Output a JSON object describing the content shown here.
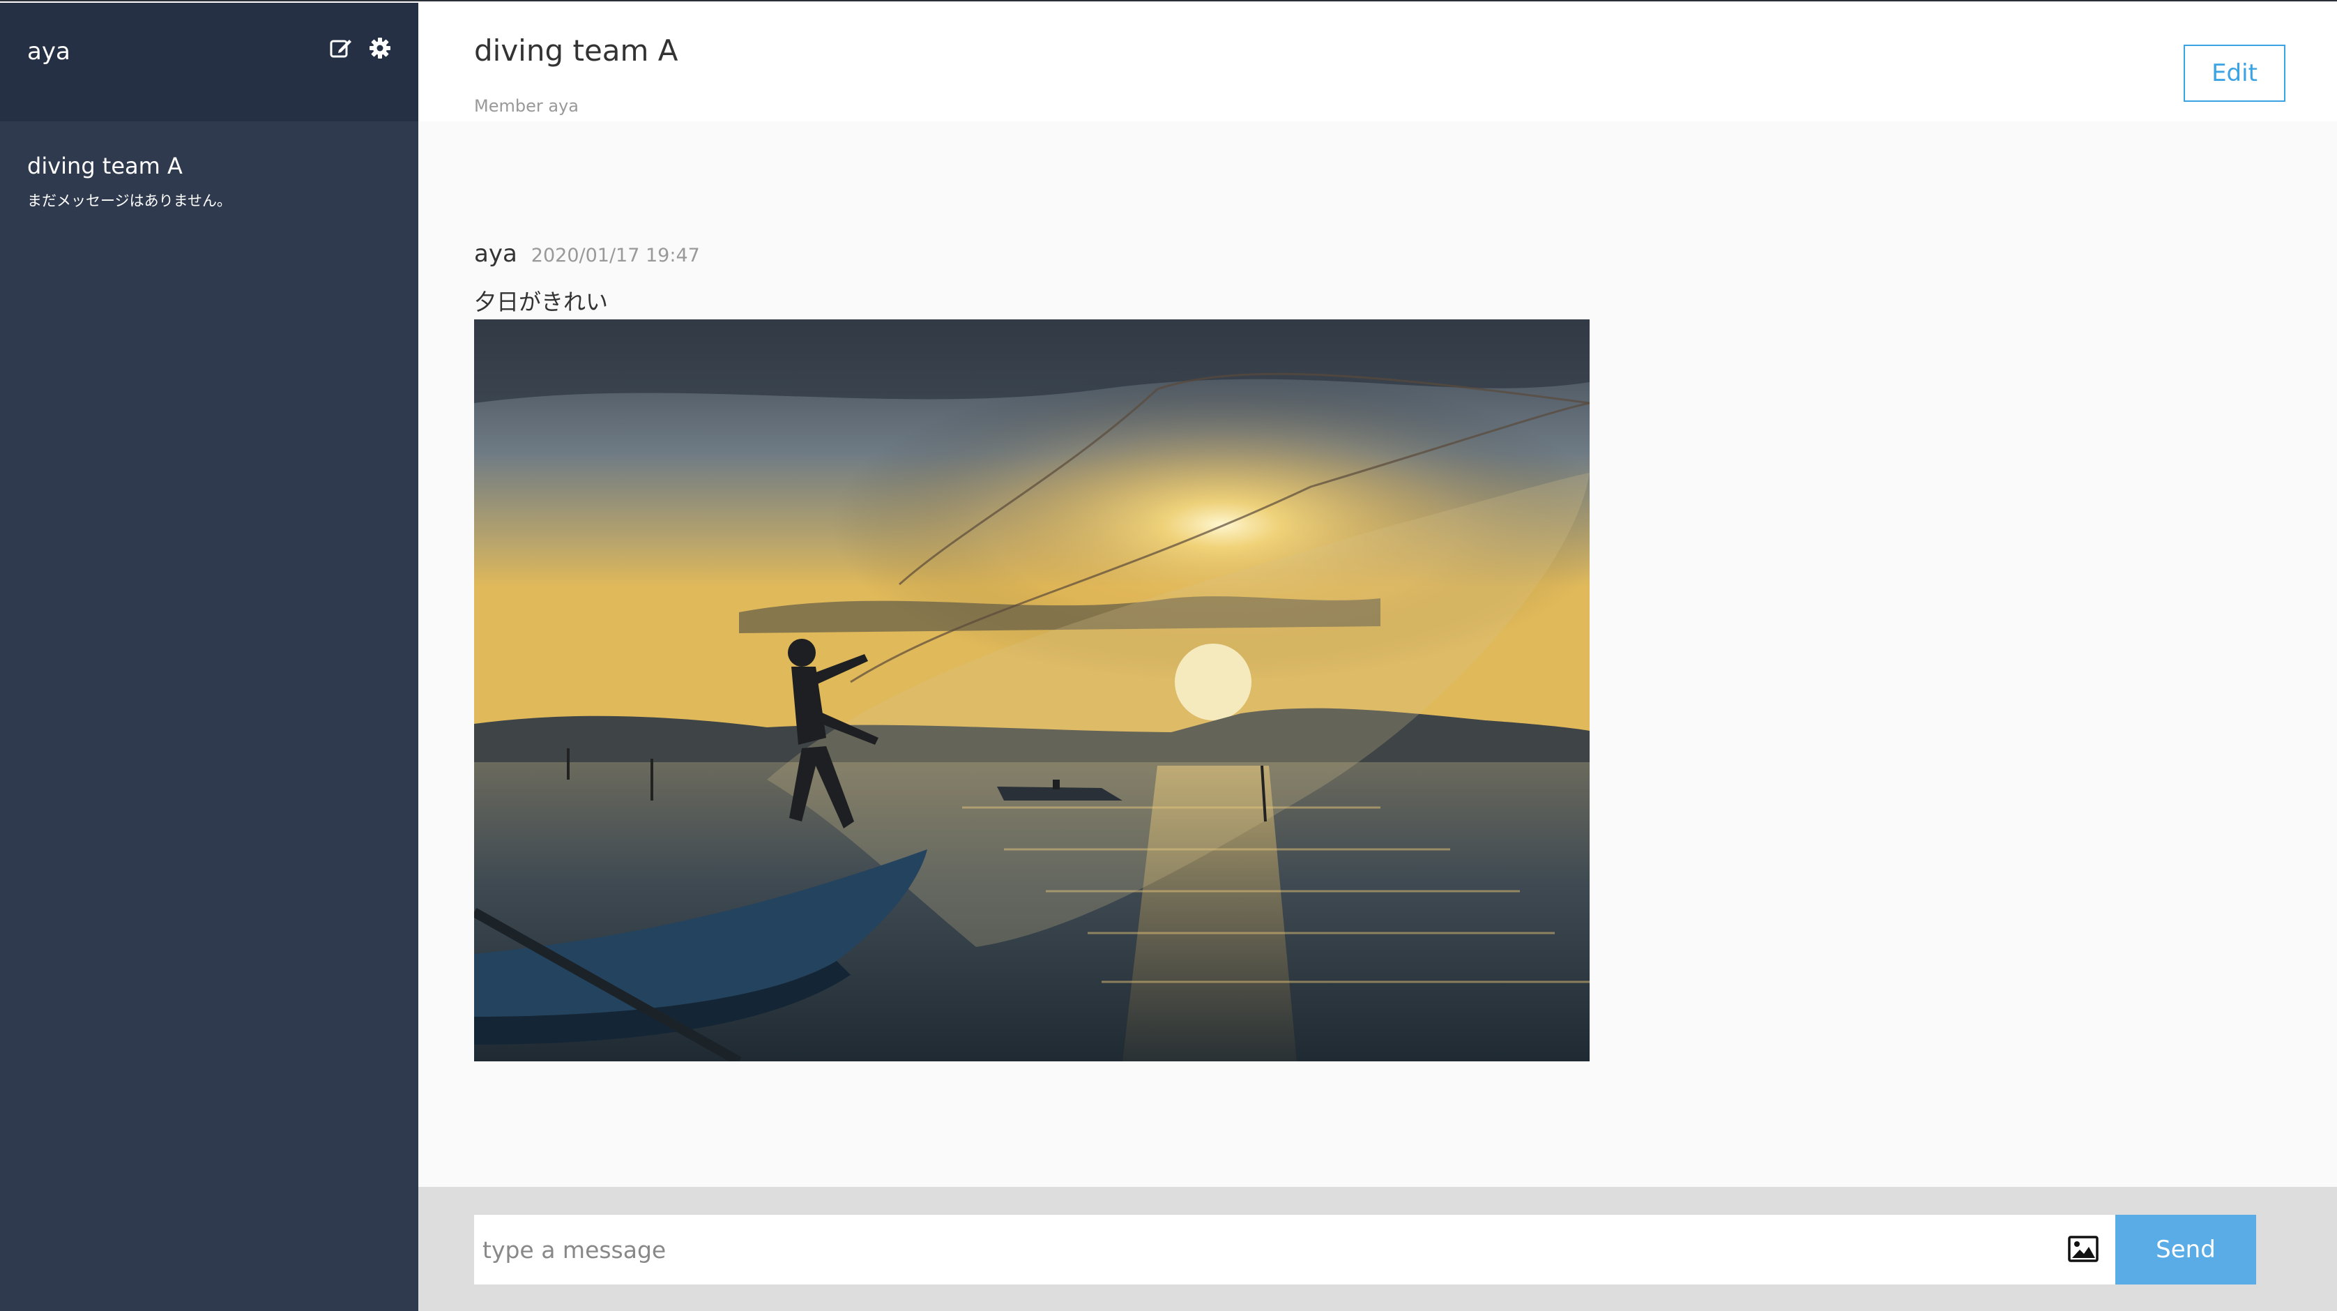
{
  "sidebar": {
    "user_name": "aya",
    "icons": {
      "edit": "edit-icon",
      "settings": "gear-icon"
    },
    "groups": [
      {
        "name": "diving team A",
        "last_message": "まだメッセージはありません。"
      }
    ]
  },
  "header": {
    "title": "diving team A",
    "members": "Member aya",
    "edit_label": "Edit"
  },
  "messages": [
    {
      "user": "aya",
      "date": "2020/01/17 19:47",
      "text": "夕日がきれい",
      "image": "fisherman-casting-net-at-sunset-photo"
    }
  ],
  "form": {
    "placeholder": "type a message",
    "image_icon": "image-icon",
    "send_label": "Send"
  },
  "colors": {
    "sidebar": "#2f3a4f",
    "sidebar_header": "#263044",
    "accent": "#3aa3e3",
    "send_button": "#59ace6",
    "form_bar": "#dddddd"
  }
}
